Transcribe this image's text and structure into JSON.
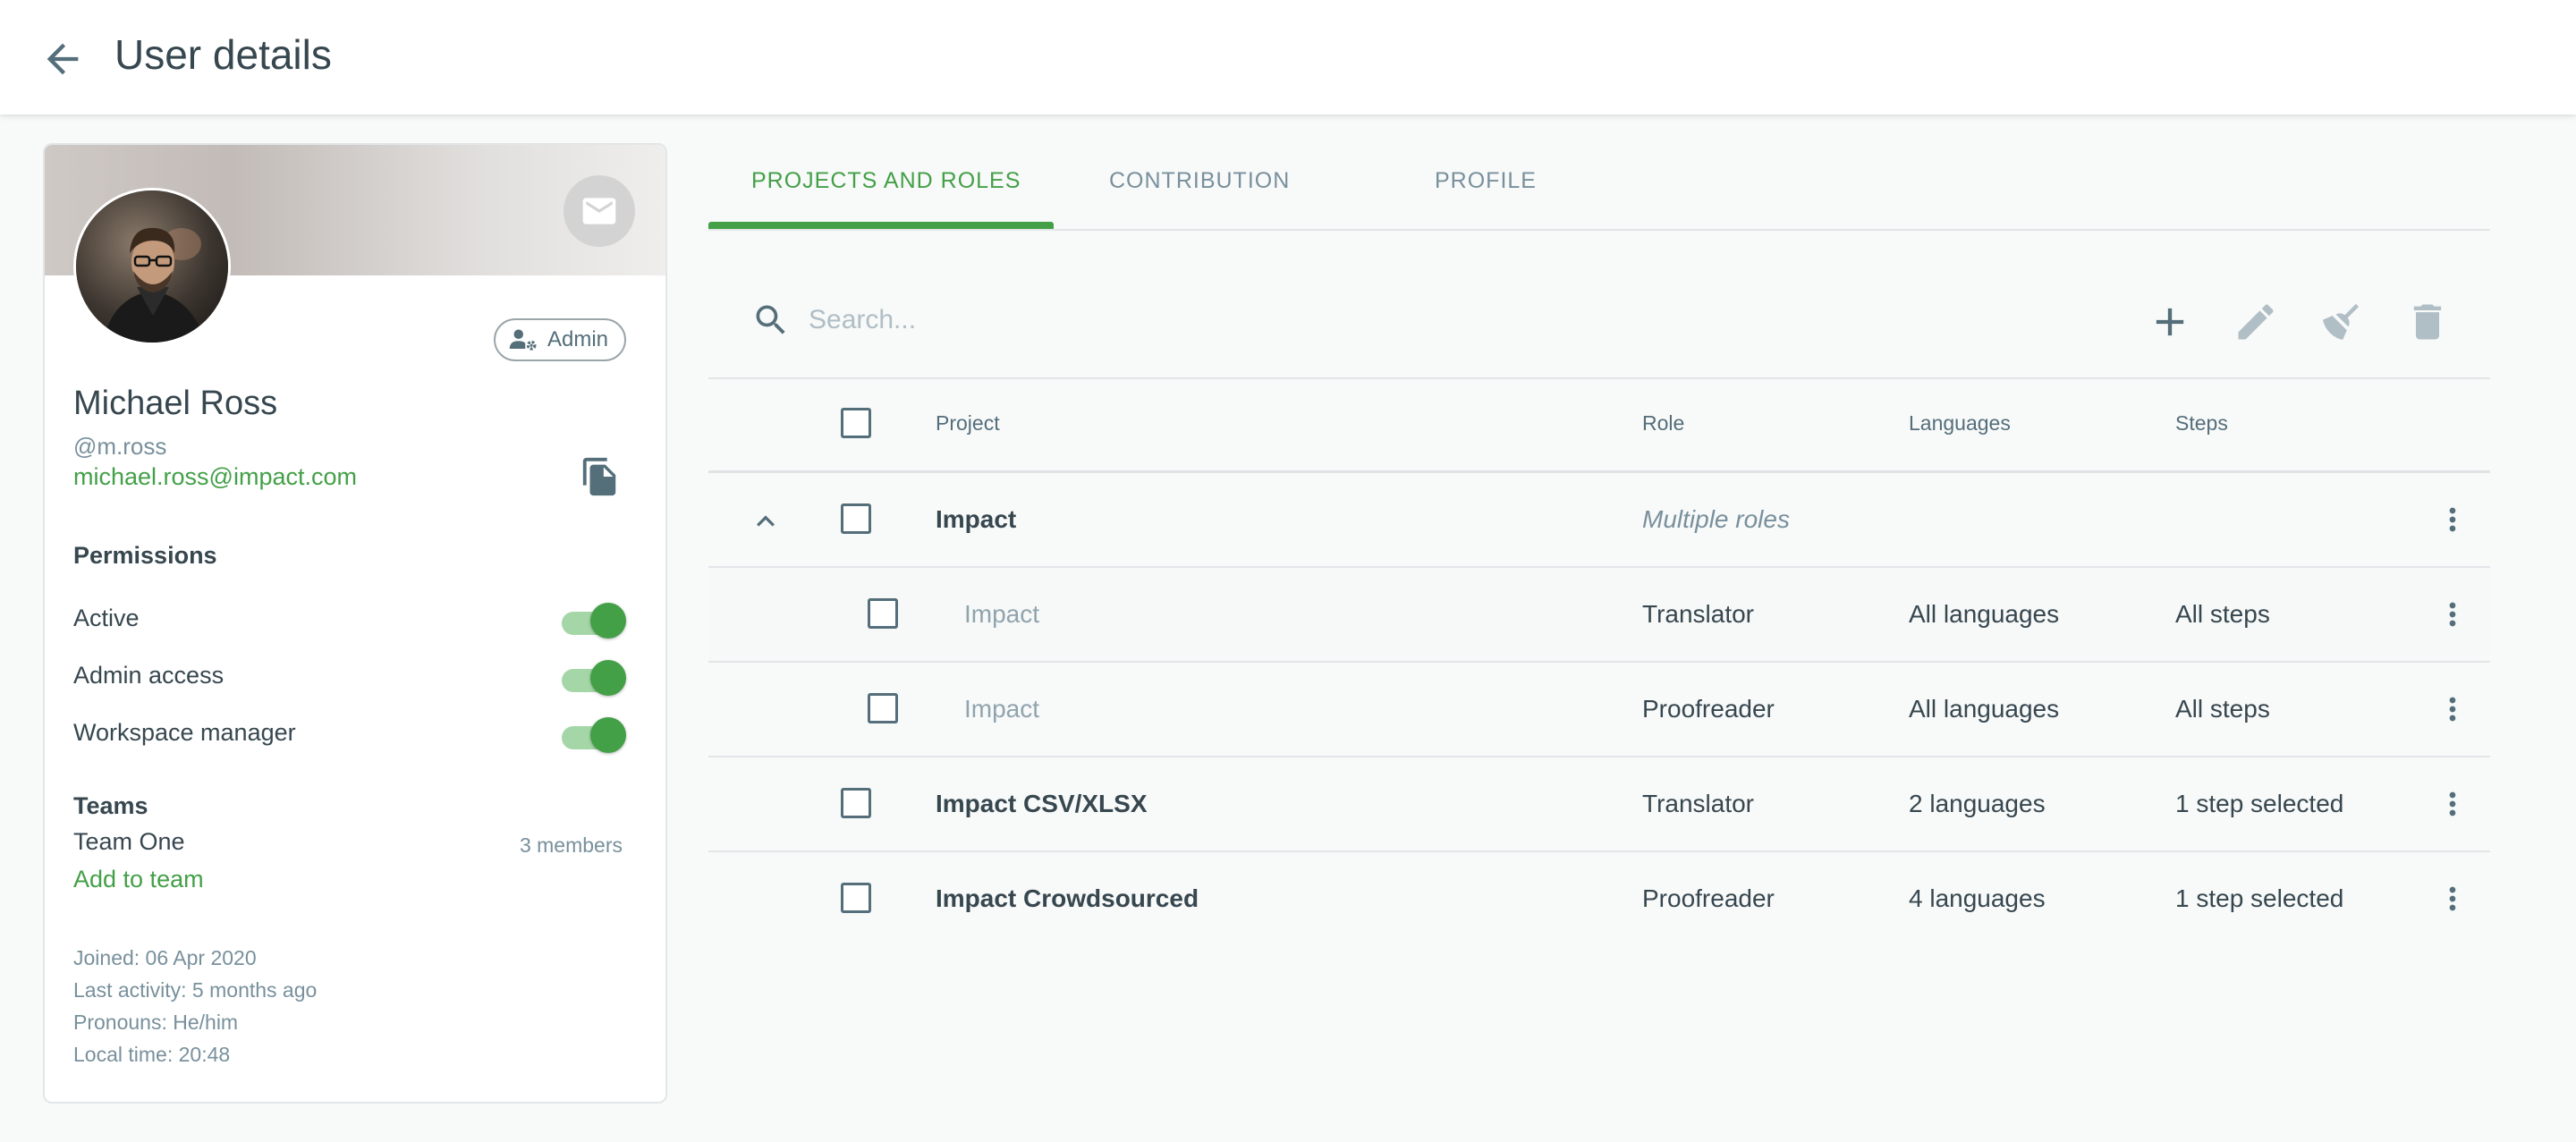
{
  "header": {
    "title": "User details"
  },
  "profile": {
    "name": "Michael Ross",
    "username": "@m.ross",
    "email": "michael.ross@impact.com",
    "role_badge": "Admin"
  },
  "permissions": {
    "title": "Permissions",
    "items": [
      {
        "label": "Active",
        "enabled": true
      },
      {
        "label": "Admin access",
        "enabled": true
      },
      {
        "label": "Workspace manager",
        "enabled": true
      }
    ]
  },
  "teams": {
    "title": "Teams",
    "items": [
      {
        "name": "Team One",
        "members": "3 members"
      }
    ],
    "add_label": "Add to team"
  },
  "meta": {
    "joined": "Joined: 06 Apr 2020",
    "last_activity": "Last activity: 5 months ago",
    "pronouns": "Pronouns: He/him",
    "local_time": "Local time: 20:48"
  },
  "tabs": [
    {
      "label": "PROJECTS AND ROLES",
      "active": true
    },
    {
      "label": "CONTRIBUTION",
      "active": false
    },
    {
      "label": "PROFILE",
      "active": false
    }
  ],
  "search": {
    "placeholder": "Search..."
  },
  "table": {
    "columns": {
      "project": "Project",
      "role": "Role",
      "languages": "Languages",
      "steps": "Steps"
    },
    "rows": [
      {
        "project": "Impact",
        "role": "Multiple roles",
        "languages": "",
        "steps": "",
        "type": "group"
      },
      {
        "project": "Impact",
        "role": "Translator",
        "languages": "All languages",
        "steps": "All steps",
        "type": "sub"
      },
      {
        "project": "Impact",
        "role": "Proofreader",
        "languages": "All languages",
        "steps": "All steps",
        "type": "sub"
      },
      {
        "project": "Impact CSV/XLSX",
        "role": "Translator",
        "languages": "2 languages",
        "steps": "1 step selected",
        "type": "top"
      },
      {
        "project": "Impact Crowdsourced",
        "role": "Proofreader",
        "languages": "4 languages",
        "steps": "1 step selected",
        "type": "top"
      }
    ]
  },
  "colors": {
    "accent": "#43a047",
    "text": "#37474f",
    "muted": "#78909c"
  }
}
